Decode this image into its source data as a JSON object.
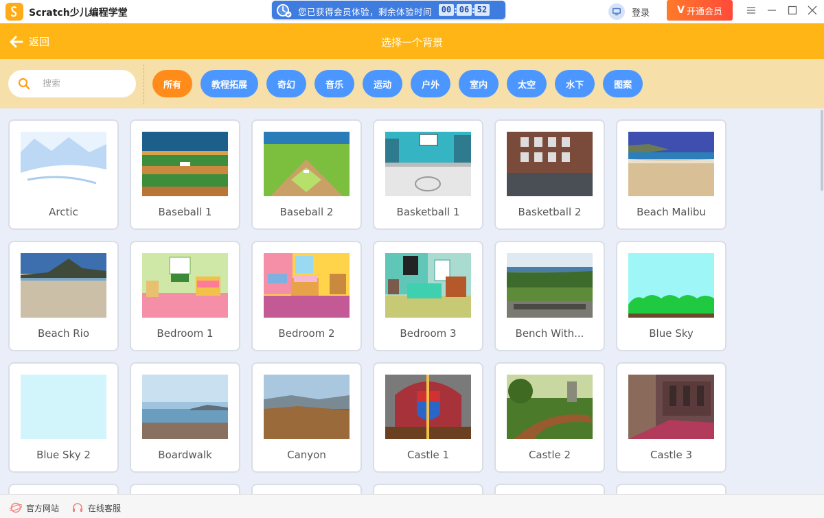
{
  "window": {
    "app_title": "Scratch少儿编程学堂",
    "trial_text": "您已获得会员体验，剩余体验时间",
    "timer": {
      "hours": "00",
      "minutes": "06",
      "seconds": "52"
    },
    "login_label": "登录",
    "vip_label": "开通会员",
    "vip_icon": "V"
  },
  "header": {
    "back_label": "返回",
    "title": "选择一个背景"
  },
  "search": {
    "placeholder": "搜索",
    "value": ""
  },
  "categories": [
    {
      "label": "所有",
      "active": true
    },
    {
      "label": "教程拓展",
      "active": false
    },
    {
      "label": "奇幻",
      "active": false
    },
    {
      "label": "音乐",
      "active": false
    },
    {
      "label": "运动",
      "active": false
    },
    {
      "label": "户外",
      "active": false
    },
    {
      "label": "室内",
      "active": false
    },
    {
      "label": "太空",
      "active": false
    },
    {
      "label": "水下",
      "active": false
    },
    {
      "label": "图案",
      "active": false
    }
  ],
  "backdrops": [
    {
      "name": "Arctic"
    },
    {
      "name": "Baseball 1"
    },
    {
      "name": "Baseball 2"
    },
    {
      "name": "Basketball 1"
    },
    {
      "name": "Basketball 2"
    },
    {
      "name": "Beach Malibu"
    },
    {
      "name": "Beach Rio"
    },
    {
      "name": "Bedroom 1"
    },
    {
      "name": "Bedroom 2"
    },
    {
      "name": "Bedroom 3"
    },
    {
      "name": "Bench With..."
    },
    {
      "name": "Blue Sky"
    },
    {
      "name": "Blue Sky 2"
    },
    {
      "name": "Boardwalk"
    },
    {
      "name": "Canyon"
    },
    {
      "name": "Castle 1"
    },
    {
      "name": "Castle 2"
    },
    {
      "name": "Castle 3"
    }
  ],
  "footer": {
    "website_label": "官方网站",
    "support_label": "在线客服"
  },
  "colors": {
    "header_orange": "#ffb515",
    "filter_bg": "#f7dfa9",
    "category_blue": "#4c97ff",
    "category_active": "#ff8c1a",
    "trial_blue": "#3f7ce0",
    "vip_red": "#ff4a3a"
  }
}
